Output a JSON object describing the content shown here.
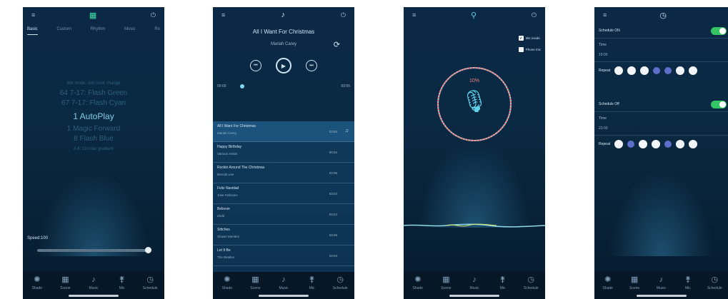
{
  "phone1": {
    "tabs": [
      "Basic",
      "Custom",
      "Rhythm",
      "Music",
      "Ro"
    ],
    "presets": [
      {
        "label": "Mix mode: soft color change",
        "size": "small"
      },
      {
        "label": "64 7-17: Flash Green",
        "size": "med"
      },
      {
        "label": "67 7-17: Flash Cyan",
        "size": "med"
      },
      {
        "label": "1 AutoPlay",
        "size": "sel"
      },
      {
        "label": "1 Magic Forward",
        "size": "med"
      },
      {
        "label": "8 Flash Blue",
        "size": "med"
      },
      {
        "label": "4 8: Circular gradient",
        "size": "small"
      }
    ],
    "speed_label": "Speed:100",
    "speed_value": 1.0
  },
  "phone2": {
    "title": "All I Want For Christmas",
    "artist": "Mariah Carey",
    "time_start": "00:00",
    "time_end": "03:55",
    "songs": [
      {
        "name": "All I Want For Christmas",
        "artist": "Mariah Carey",
        "dur": "03:55",
        "current": true
      },
      {
        "name": "Happy Birthday",
        "artist": "Various Artists",
        "dur": "00:52",
        "current": false
      },
      {
        "name": "Rockin Around The Christmas",
        "artist": "Brenda Lee",
        "dur": "02:06",
        "current": false
      },
      {
        "name": "Feliz Navidad",
        "artist": "Jose Feliciano",
        "dur": "03:02",
        "current": false
      },
      {
        "name": "Believer",
        "artist": "Zedd",
        "dur": "03:24",
        "current": false
      },
      {
        "name": "Stitches",
        "artist": "Shawn Mendes",
        "dur": "03:26",
        "current": false
      },
      {
        "name": "Let It Be",
        "artist": "The Beatles",
        "dur": "04:03",
        "current": false
      }
    ]
  },
  "phone3": {
    "options": [
      "Mic inside",
      "Phone mic"
    ],
    "percent": "10%",
    "percent_value": 0.1
  },
  "phone4": {
    "schedule_on_label": "Schedule ON",
    "schedule_off_label": "Schedule Off",
    "time_label": "Time",
    "time_on_value": "19:00",
    "time_off_value": "23:00",
    "repeat_label": "Repeat",
    "days_on": [
      true,
      true,
      true,
      false,
      false,
      true,
      true
    ],
    "days_off": [
      true,
      false,
      true,
      true,
      false,
      true,
      true
    ]
  },
  "nav": {
    "items": [
      {
        "label": "Shade",
        "icon": "sun-icon",
        "glyph": "✺"
      },
      {
        "label": "Scene",
        "icon": "grid-icon",
        "glyph": "▦"
      },
      {
        "label": "Music",
        "icon": "note-icon",
        "glyph": "♪"
      },
      {
        "label": "Mic",
        "icon": "mic-icon",
        "glyph": "⚵"
      },
      {
        "label": "Schedule",
        "icon": "clock-icon",
        "glyph": "◷"
      }
    ]
  },
  "colors": {
    "bg": "#0b2845",
    "accent": "#5ed3ea",
    "toggle_on": "#33c463",
    "ring_progress": "#f08080",
    "day_off": "#5c6fc8"
  }
}
